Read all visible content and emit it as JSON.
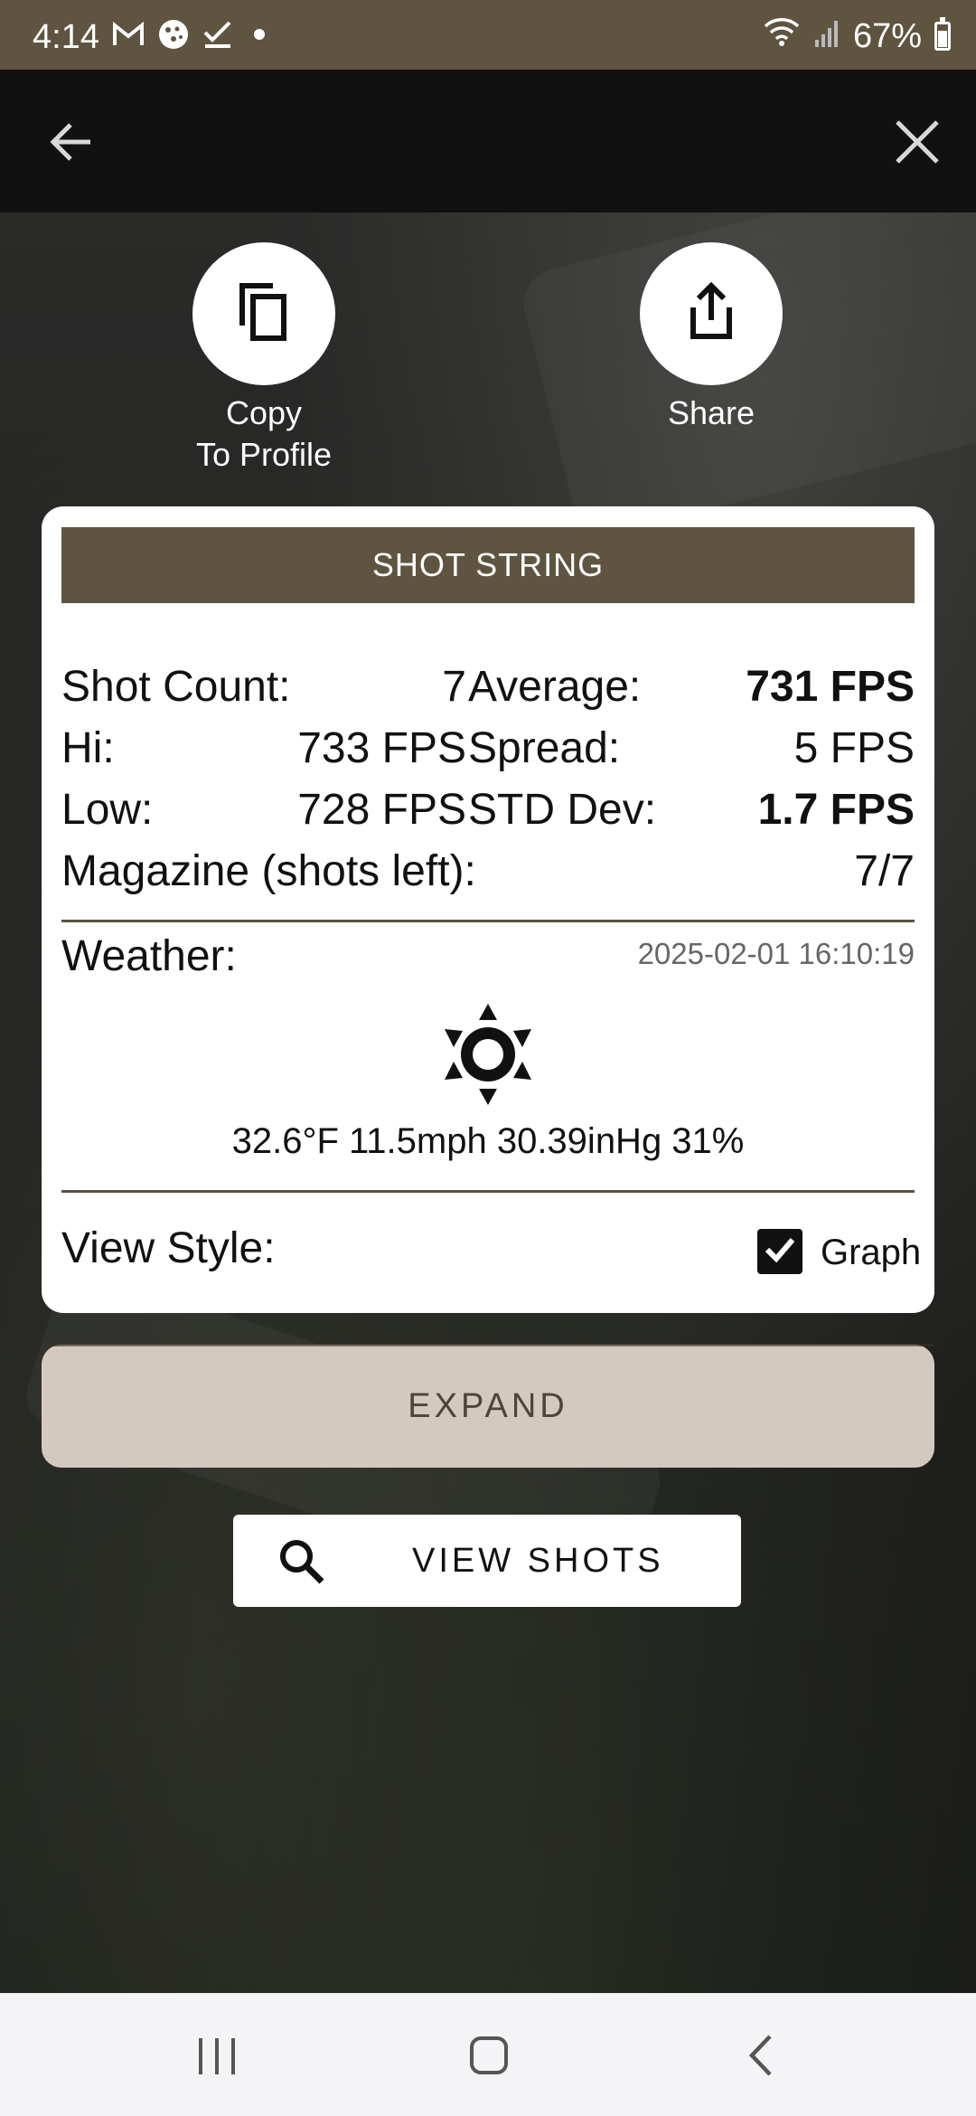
{
  "status_bar": {
    "time": "4:14",
    "battery": "67%",
    "icons": [
      "gmail-icon",
      "cookie-icon",
      "checkmark-icon",
      "dot-icon",
      "wifi-icon",
      "signal-icon",
      "battery-icon"
    ]
  },
  "toolbar": {
    "back_icon": "arrow-left-icon",
    "close_icon": "close-icon"
  },
  "actions": {
    "copy_label": "Copy\nTo Profile",
    "share_label": "Share"
  },
  "card": {
    "header": "SHOT STRING",
    "shot_count_label": "Shot Count:",
    "shot_count_value": "7",
    "average_label": "Average:",
    "average_value": "731 FPS",
    "hi_label": "Hi:",
    "hi_value": "733 FPS",
    "spread_label": "Spread:",
    "spread_value": "5 FPS",
    "low_label": "Low:",
    "low_value": "728 FPS",
    "std_label": "STD Dev:",
    "std_value": "1.7 FPS",
    "magazine_label": "Magazine (shots left):",
    "magazine_value": "7/7",
    "weather_label": "Weather:",
    "weather_date": "2025-02-01 16:10:19",
    "weather_values": "32.6°F 11.5mph 30.39inHg 31%",
    "view_style_label": "View Style:",
    "graph_label": "Graph",
    "graph_checked": true
  },
  "expand_label": "EXPAND",
  "view_shots_label": "VIEW SHOTS",
  "colors": {
    "brand": "#5e5440",
    "expand_bg": "#d4c9bf",
    "toolbar_bg": "#111111"
  }
}
